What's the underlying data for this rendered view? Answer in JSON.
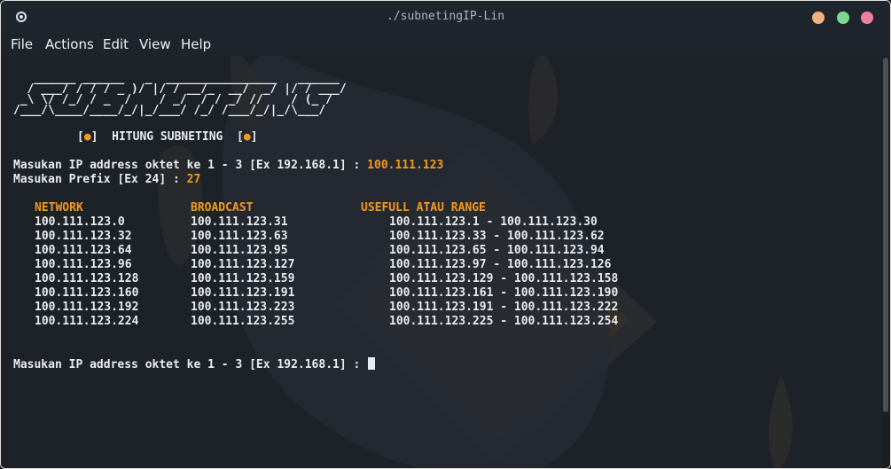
{
  "window": {
    "title": "./subnetingIP-Lin",
    "buttons": {
      "minimize_color": "#f2b17c",
      "maximize_color": "#7fd68e",
      "close_color": "#ef7fa0"
    }
  },
  "menu": [
    "File",
    "Actions",
    "Edit",
    "View",
    "Help"
  ],
  "terminal": {
    "banner_ascii": "   ______ ______   _  ________________   ______\n  / ___/ / / / _ )/ |/ / __/_  __/  _/ |/ / ___/\n _\\ \\/ /_/ / _  /    / _/  / / _/ //    / (_ /\n/___/\\____/____/_/|_/___/ /_/ /___/_/|_/\\___/",
    "banner_title": "HITUNG SUBNETING",
    "banner_bracket_left": "[",
    "banner_bracket_right": "]",
    "banner_dot": "●",
    "prompt_ip": "Masukan IP address oktet ke 1 - 3 [Ex 192.168.1] : ",
    "input_ip": "100.111.123",
    "prompt_prefix": "Masukan Prefix [Ex 24] : ",
    "input_prefix": "27",
    "headers": {
      "network": "NETWORK",
      "broadcast": "BROADCAST",
      "range": "USEFULL ATAU RANGE"
    },
    "rows": [
      {
        "network": "100.111.123.0",
        "broadcast": "100.111.123.31",
        "range": "100.111.123.1 - 100.111.123.30"
      },
      {
        "network": "100.111.123.32",
        "broadcast": "100.111.123.63",
        "range": "100.111.123.33 - 100.111.123.62"
      },
      {
        "network": "100.111.123.64",
        "broadcast": "100.111.123.95",
        "range": "100.111.123.65 - 100.111.123.94"
      },
      {
        "network": "100.111.123.96",
        "broadcast": "100.111.123.127",
        "range": "100.111.123.97 - 100.111.123.126"
      },
      {
        "network": "100.111.123.128",
        "broadcast": "100.111.123.159",
        "range": "100.111.123.129 - 100.111.123.158"
      },
      {
        "network": "100.111.123.160",
        "broadcast": "100.111.123.191",
        "range": "100.111.123.161 - 100.111.123.190"
      },
      {
        "network": "100.111.123.192",
        "broadcast": "100.111.123.223",
        "range": "100.111.123.191 - 100.111.123.222"
      },
      {
        "network": "100.111.123.224",
        "broadcast": "100.111.123.255",
        "range": "100.111.123.225 - 100.111.123.254"
      }
    ],
    "prompt_again": "Masukan IP address oktet ke 1 - 3 [Ex 192.168.1] : "
  },
  "colors": {
    "accent_orange": "#f39a1e",
    "terminal_bg": "#1d2229",
    "text": "#e9ecef"
  }
}
